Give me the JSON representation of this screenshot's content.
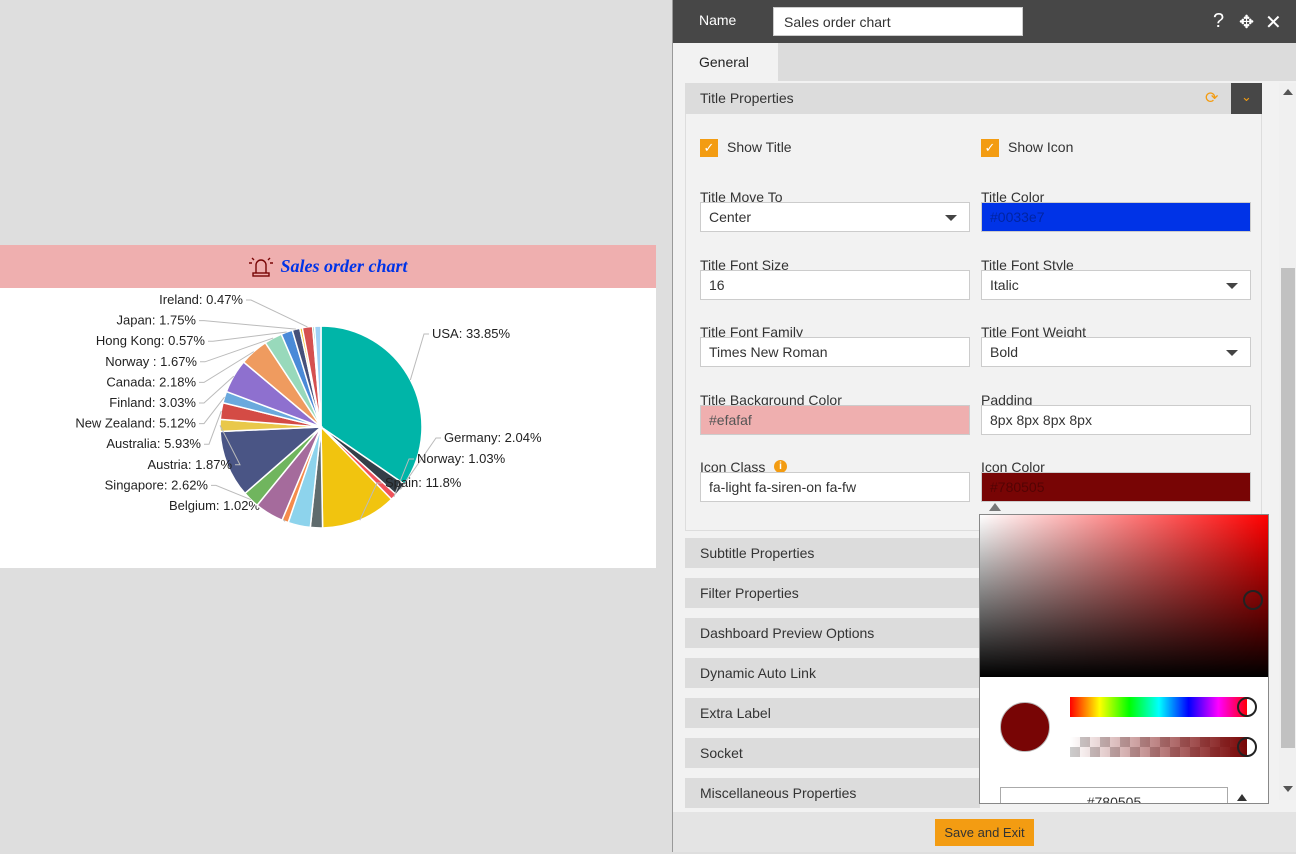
{
  "chart_card": {
    "title": "Sales order chart",
    "title_color": "#0033e7",
    "title_bg": "#efafaf",
    "icon": "siren-icon",
    "icon_color": "#780505"
  },
  "chart_data": {
    "type": "pie",
    "title": "Sales order chart",
    "slices": [
      {
        "label": "USA: 33.85%",
        "value": 33.85,
        "color": "#00b5a8",
        "side": "right"
      },
      {
        "label": "Germany: 2.04%",
        "value": 2.04,
        "color": "#343f48",
        "side": "right"
      },
      {
        "label": "Norway: 1.03%",
        "value": 1.03,
        "color": "#f0525a",
        "side": "right"
      },
      {
        "label": "Spain: 11.8%",
        "value": 11.8,
        "color": "#f1c40f",
        "side": "right"
      },
      {
        "label": "",
        "value": 1.9,
        "color": "#5f6b6d"
      },
      {
        "label": "",
        "value": 3.5,
        "color": "#8dd3ec"
      },
      {
        "label": "Belgium: 1.02%",
        "value": 1.02,
        "color": "#f58b4c",
        "side": "left"
      },
      {
        "label": "",
        "value": 4.5,
        "color": "#a56b9c"
      },
      {
        "label": "Singapore: 2.62%",
        "value": 2.62,
        "color": "#70b55e",
        "side": "left"
      },
      {
        "label": "",
        "value": 10.5,
        "color": "#4a5585"
      },
      {
        "label": "Austria: 1.87%",
        "value": 1.87,
        "color": "#e9c84a",
        "side": "left"
      },
      {
        "label": "Australia: 5.93%",
        "value": 2.6,
        "color": "#d44b45",
        "side": "left"
      },
      {
        "label": "New Zealand: 5.12%",
        "value": 1.8,
        "color": "#6aa9dd",
        "side": "left"
      },
      {
        "label": "Finland: 3.03%",
        "value": 5.3,
        "color": "#8e70cf",
        "side": "left"
      },
      {
        "label": "Canada: 2.18%",
        "value": 4.5,
        "color": "#ef9b5f",
        "side": "left"
      },
      {
        "label": "Norway : 1.67%",
        "value": 2.8,
        "color": "#98d9bb",
        "side": "left"
      },
      {
        "label": "Hong Kong: 0.57%",
        "value": 1.8,
        "color": "#4a8ad8",
        "side": "left"
      },
      {
        "label": "Japan: 1.75%",
        "value": 1.2,
        "color": "#46507a",
        "side": "left"
      },
      {
        "label": "",
        "value": 0.4,
        "color": "#f0c020"
      },
      {
        "label": "Ireland: 0.47%",
        "value": 1.6,
        "color": "#d55050",
        "side": "left"
      },
      {
        "label": "",
        "value": 0.3,
        "color": "#3aa070"
      },
      {
        "label": "",
        "value": 1.0,
        "color": "#9fd0f5"
      }
    ]
  },
  "panel": {
    "name_label": "Name",
    "name_value": "Sales order chart",
    "tab": "General",
    "section": "Title Properties",
    "show_title": "Show Title",
    "show_icon": "Show Icon",
    "fields": {
      "move_to": {
        "label": "Title Move To",
        "value": "Center"
      },
      "title_color": {
        "label": "Title Color",
        "value": "#0033e7"
      },
      "font_size": {
        "label": "Title Font Size",
        "value": "16"
      },
      "font_style": {
        "label": "Title Font Style",
        "value": "Italic"
      },
      "font_family": {
        "label": "Title Font Family",
        "value": "Times New Roman"
      },
      "font_weight": {
        "label": "Title Font Weight",
        "value": "Bold"
      },
      "bg_color": {
        "label": "Title Background Color",
        "value": "#efafaf"
      },
      "padding": {
        "label": "Padding",
        "value": "8px 8px 8px 8px"
      },
      "icon_class": {
        "label": "Icon Class",
        "value": "fa-light fa-siren-on fa-fw"
      },
      "icon_color": {
        "label": "Icon Color",
        "value": "#780505"
      }
    },
    "sections": [
      "Subtitle Properties",
      "Filter Properties",
      "Dashboard Preview Options",
      "Dynamic Auto Link",
      "Extra Label",
      "Socket",
      "Miscellaneous Properties"
    ],
    "picker_hex": "#780505",
    "save": "Save and Exit",
    "accent": "#f39c12"
  }
}
